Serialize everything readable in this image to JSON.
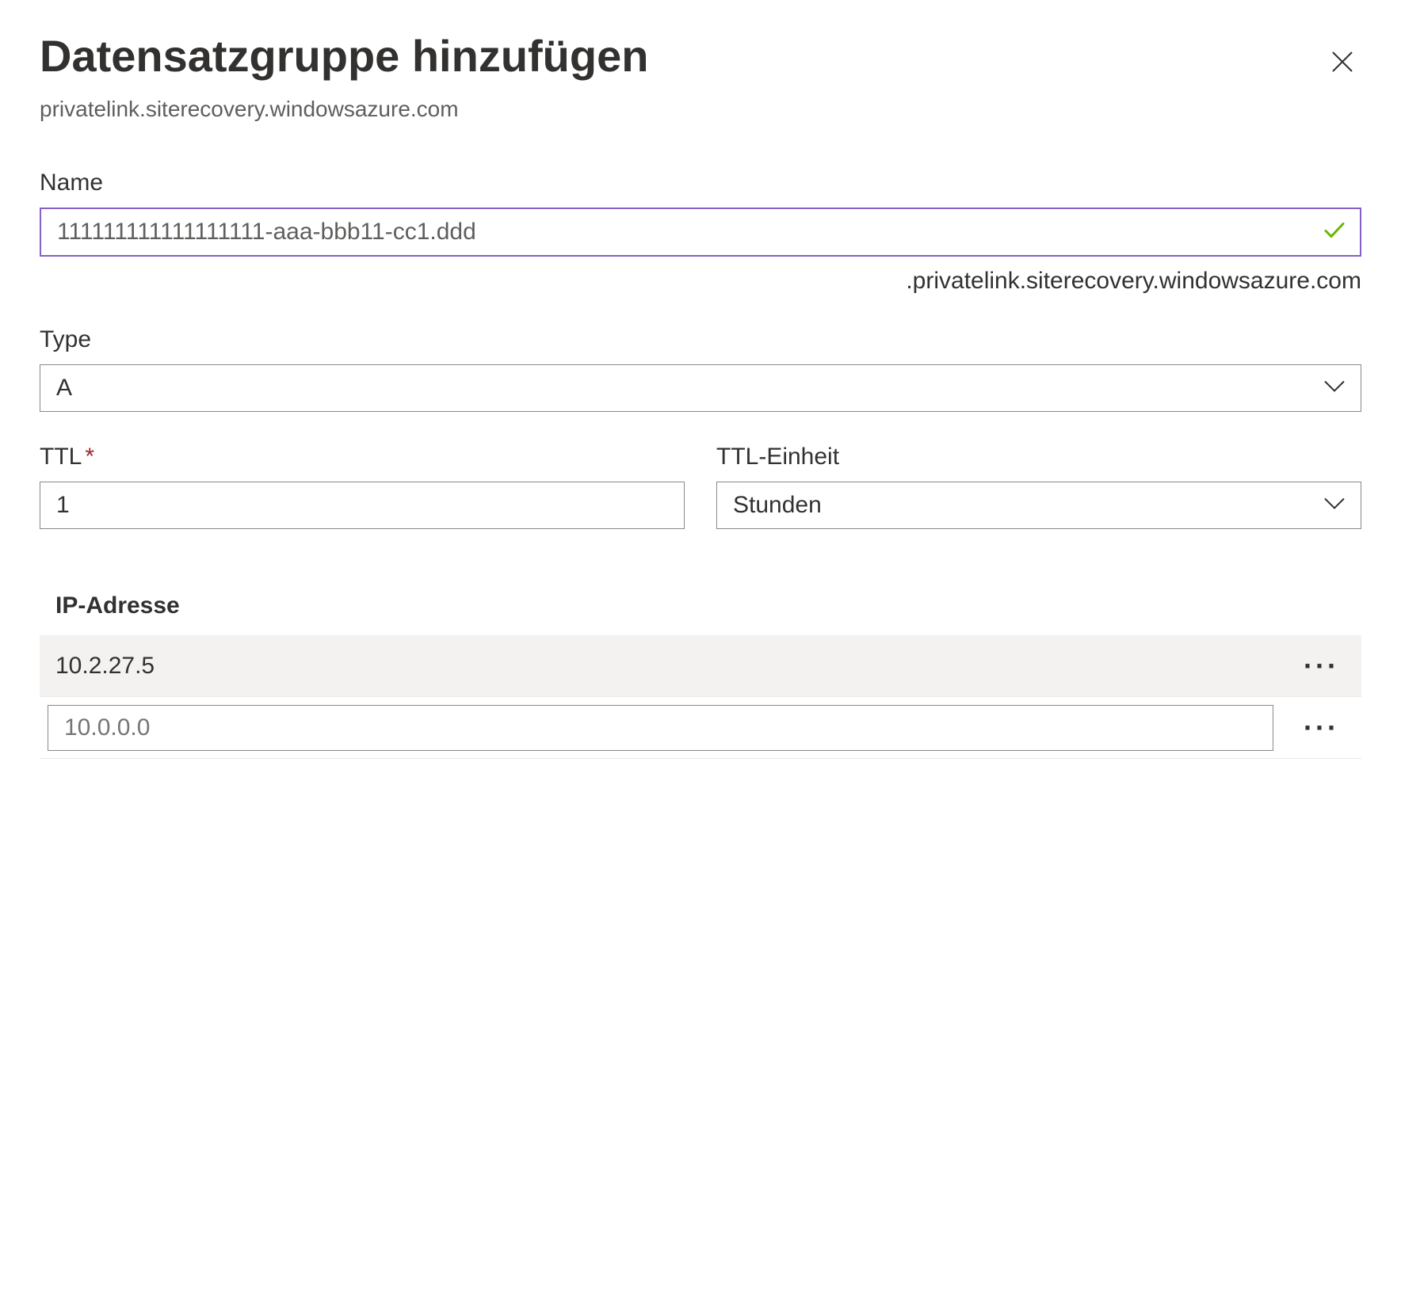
{
  "header": {
    "title": "Datensatzgruppe hinzufügen",
    "subtitle": "privatelink.siterecovery.windowsazure.com"
  },
  "fields": {
    "name": {
      "label": "Name",
      "value": "111111111111111111-aaa-bbb11-cc1.ddd",
      "suffix": ".privatelink.siterecovery.windowsazure.com"
    },
    "type": {
      "label": "Type",
      "value": "A"
    },
    "ttl": {
      "label": "TTL",
      "value": "1"
    },
    "ttlUnit": {
      "label": "TTL-Einheit",
      "value": "Stunden"
    }
  },
  "ipSection": {
    "header": "IP-Adresse",
    "entries": [
      {
        "value": "10.2.27.5"
      }
    ],
    "newPlaceholder": "10.0.0.0"
  }
}
